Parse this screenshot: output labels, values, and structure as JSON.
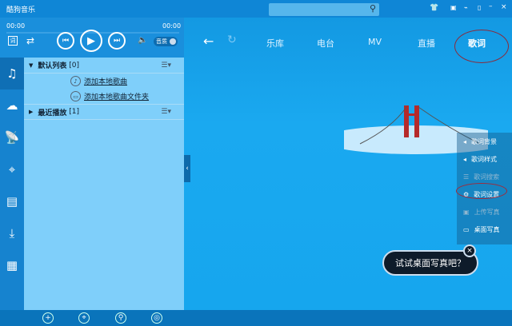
{
  "app": {
    "title": "酷狗音乐"
  },
  "player": {
    "time_start": "00:00",
    "time_end": "00:00",
    "mute_label": "音质"
  },
  "nav": {
    "tabs": [
      "乐库",
      "电台",
      "MV",
      "直播",
      "歌词"
    ]
  },
  "playlist": {
    "groups": [
      {
        "label": "默认列表",
        "count": "[0]"
      },
      {
        "label": "最近播放",
        "count": "[1]"
      }
    ],
    "add_local_songs": "添加本地歌曲",
    "add_local_folder": "添加本地歌曲文件夹"
  },
  "lyrics_menu": {
    "items": [
      "歌词背景",
      "歌词样式",
      "歌词搜索",
      "歌词设置",
      "上传写真",
      "桌面写真"
    ]
  },
  "tip": {
    "text": "试试桌面写真吧？"
  }
}
